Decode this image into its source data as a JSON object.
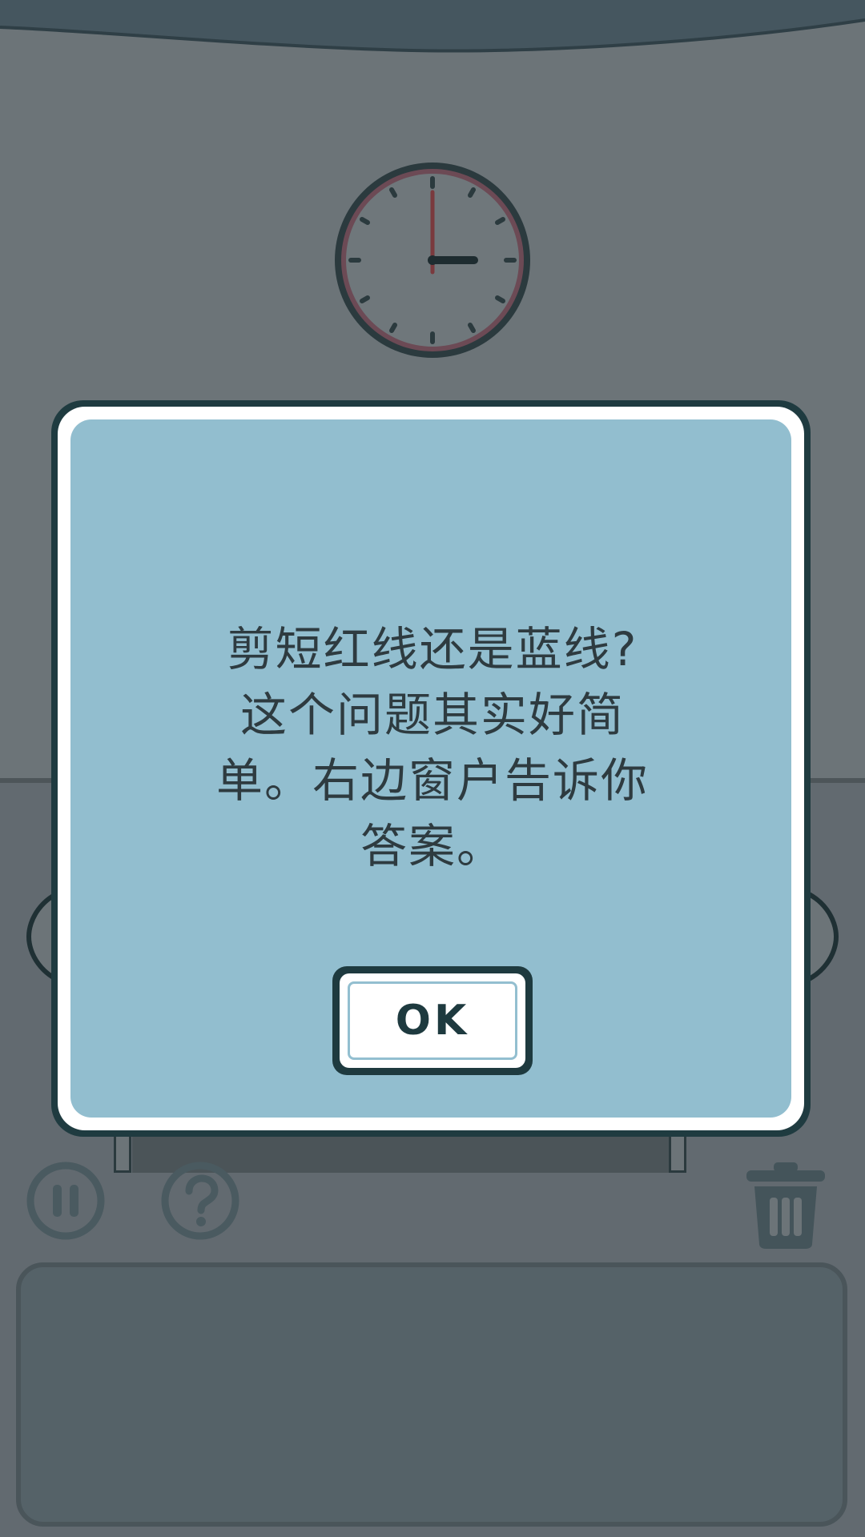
{
  "dialog": {
    "message": "剪短红线还是蓝线?\n这个问题其实好简\n单。右边窗户告诉你\n答案。",
    "ok_label": "OK"
  },
  "scene": {
    "clock_time": "3:00"
  },
  "toolbar": {
    "pause_icon": "pause-icon",
    "help_icon": "help-icon",
    "trash_icon": "trash-icon"
  },
  "colors": {
    "dialog_bg": "#92becf",
    "dialog_outline": "#1f3b40",
    "text": "#2e3b40",
    "wall": "#6c7478",
    "tray": "#556268"
  }
}
